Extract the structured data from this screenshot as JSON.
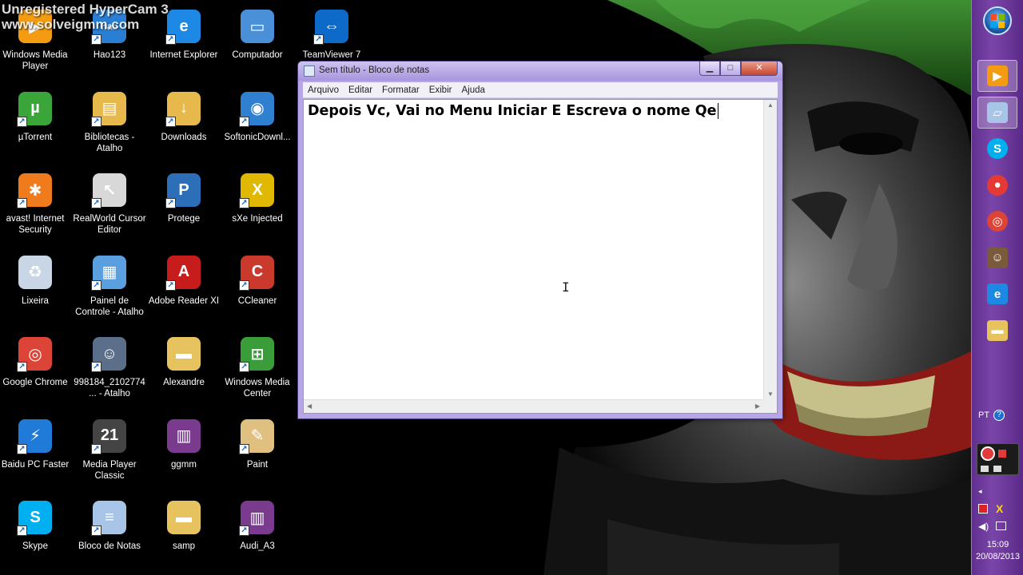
{
  "watermark": {
    "line1": "Unregistered HyperCam 3",
    "line2": "www.solveigmm.com"
  },
  "desktop_icons": [
    {
      "label": "Windows Media Player",
      "icon": "windows-media-player-icon"
    },
    {
      "label": "Hao123",
      "icon": "hao123-icon"
    },
    {
      "label": "Internet Explorer",
      "icon": "internet-explorer-icon"
    },
    {
      "label": "Computador",
      "icon": "computer-icon"
    },
    {
      "label": "TeamViewer 7",
      "icon": "teamviewer-icon"
    },
    {
      "label": "µTorrent",
      "icon": "utorrent-icon"
    },
    {
      "label": "Bibliotecas - Atalho",
      "icon": "libraries-icon"
    },
    {
      "label": "Downloads",
      "icon": "downloads-folder-icon"
    },
    {
      "label": "SoftonicDownl...",
      "icon": "softonic-icon"
    },
    {
      "label": "avast! Internet Security",
      "icon": "avast-icon"
    },
    {
      "label": "RealWorld Cursor Editor",
      "icon": "cursor-editor-icon"
    },
    {
      "label": "Protege",
      "icon": "protege-shield-icon"
    },
    {
      "label": "sXe Injected",
      "icon": "sxe-icon"
    },
    {
      "label": "Lixeira",
      "icon": "recycle-bin-icon"
    },
    {
      "label": "Painel de Controle - Atalho",
      "icon": "control-panel-icon"
    },
    {
      "label": "Adobe Reader XI",
      "icon": "adobe-reader-icon"
    },
    {
      "label": "CCleaner",
      "icon": "ccleaner-icon"
    },
    {
      "label": "Google Chrome",
      "icon": "chrome-icon"
    },
    {
      "label": "998184_2102774... - Atalho",
      "icon": "photo-shortcut-icon"
    },
    {
      "label": "Alexandre",
      "icon": "folder-icon"
    },
    {
      "label": "Windows Media Center",
      "icon": "media-center-icon"
    },
    {
      "label": "Baidu PC Faster",
      "icon": "baidu-icon"
    },
    {
      "label": "Media Player Classic",
      "icon": "media-player-classic-icon"
    },
    {
      "label": "ggmm",
      "icon": "winrar-icon"
    },
    {
      "label": "Paint",
      "icon": "paint-icon"
    },
    {
      "label": "Skype",
      "icon": "skype-icon"
    },
    {
      "label": "Bloco de Notas",
      "icon": "notepad-icon"
    },
    {
      "label": "samp",
      "icon": "folder-icon"
    },
    {
      "label": "Audi_A3",
      "icon": "winrar-icon"
    }
  ],
  "notepad": {
    "title": "Sem título - Bloco de notas",
    "menu": [
      "Arquivo",
      "Editar",
      "Formatar",
      "Exibir",
      "Ajuda"
    ],
    "content": "Depois Vc, Vai no Menu Iniciar E Escreva o nome Qe",
    "min_label": "▁",
    "max_label": "□",
    "close_label": "✕"
  },
  "taskbar": {
    "items": [
      {
        "icon": "media-player-icon",
        "active": true
      },
      {
        "icon": "notepad-icon",
        "active": true
      },
      {
        "icon": "skype-icon",
        "active": false
      },
      {
        "icon": "record-icon",
        "active": false
      },
      {
        "icon": "chrome-icon",
        "active": false
      },
      {
        "icon": "user-avatar-icon",
        "active": false
      },
      {
        "icon": "internet-explorer-icon",
        "active": false
      },
      {
        "icon": "explorer-folder-icon",
        "active": false
      }
    ],
    "language": "PT",
    "clock_time": "15:09",
    "clock_date": "20/08/2013"
  },
  "colors": {
    "taskbar": "#6b3a9a",
    "window_frame": "#b7a6e6",
    "joker_green": "#2f7a2a",
    "joker_red": "#8b1a16"
  }
}
